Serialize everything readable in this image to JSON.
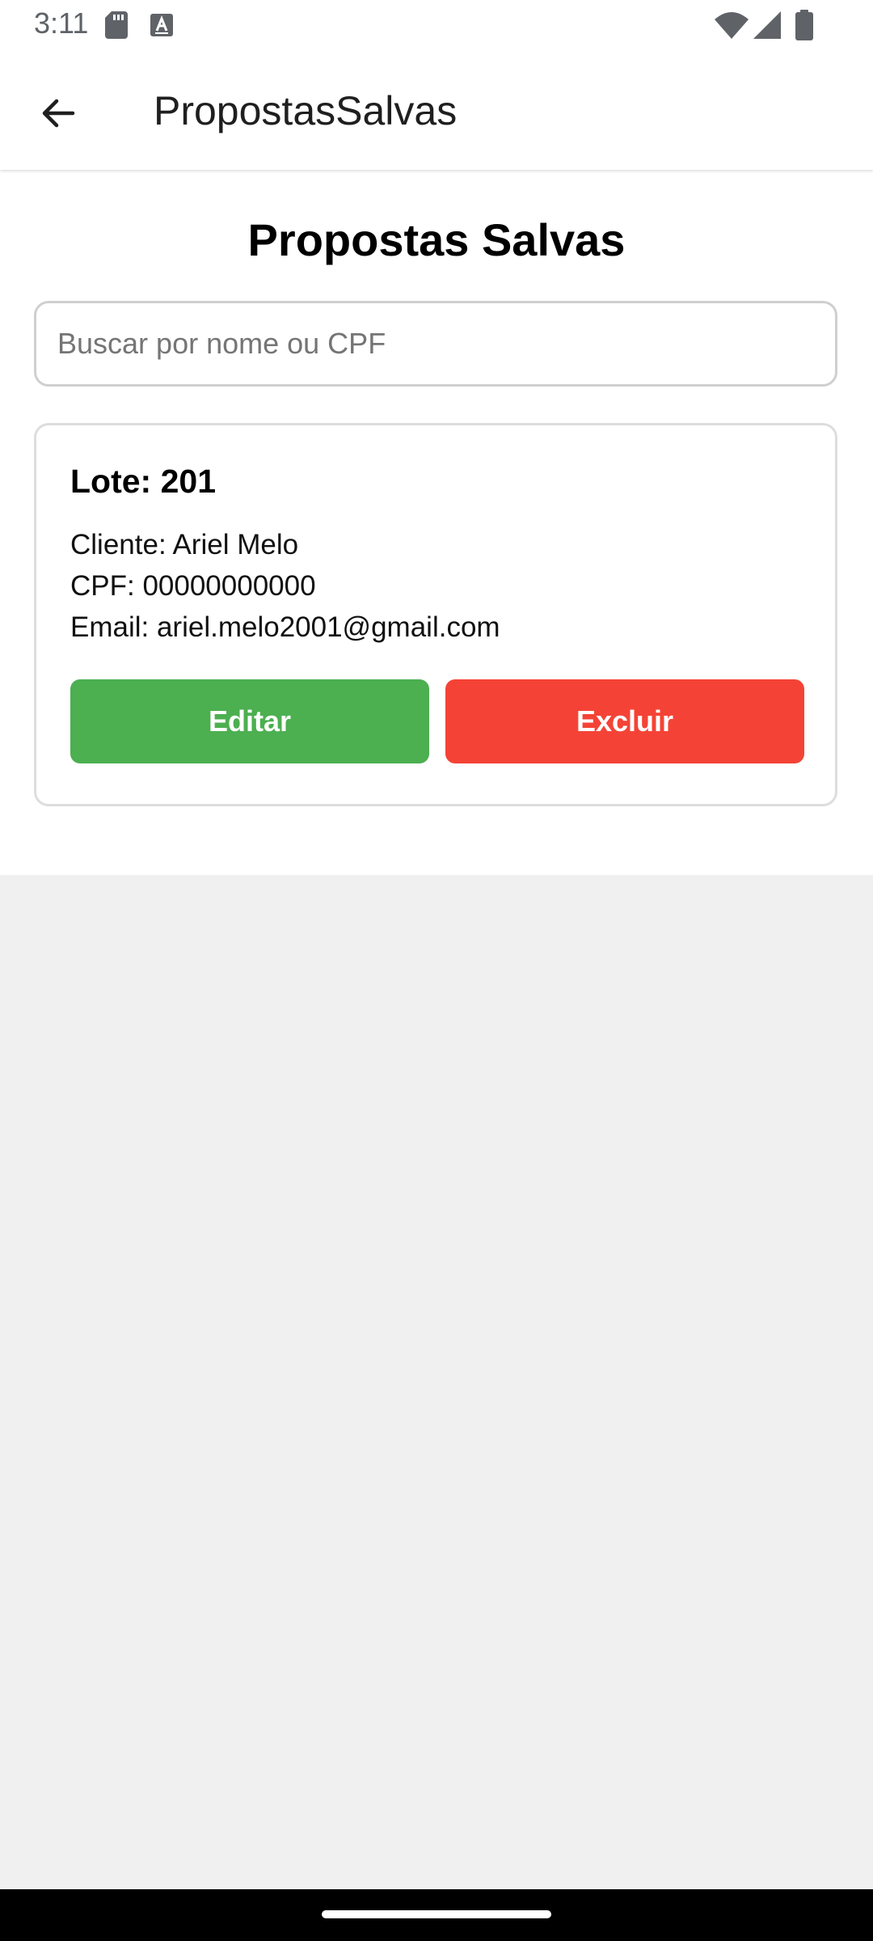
{
  "status_bar": {
    "time": "3:11",
    "icons": [
      "sd-card-icon",
      "a-icon",
      "wifi-icon",
      "signal-icon",
      "battery-icon"
    ]
  },
  "app_bar": {
    "title": "PropostasSalvas",
    "back_icon": "arrow-back-icon"
  },
  "page": {
    "title": "Propostas Salvas"
  },
  "search": {
    "placeholder": "Buscar por nome ou CPF",
    "value": ""
  },
  "proposals": [
    {
      "lote": "Lote: 201",
      "cliente": "Cliente: Ariel Melo",
      "cpf": "CPF: 00000000000",
      "email": "Email: ariel.melo2001@gmail.com",
      "edit_label": "Editar",
      "delete_label": "Excluir"
    }
  ],
  "colors": {
    "edit_button": "#4caf50",
    "delete_button": "#f44336",
    "background": "#f0f0f0"
  }
}
